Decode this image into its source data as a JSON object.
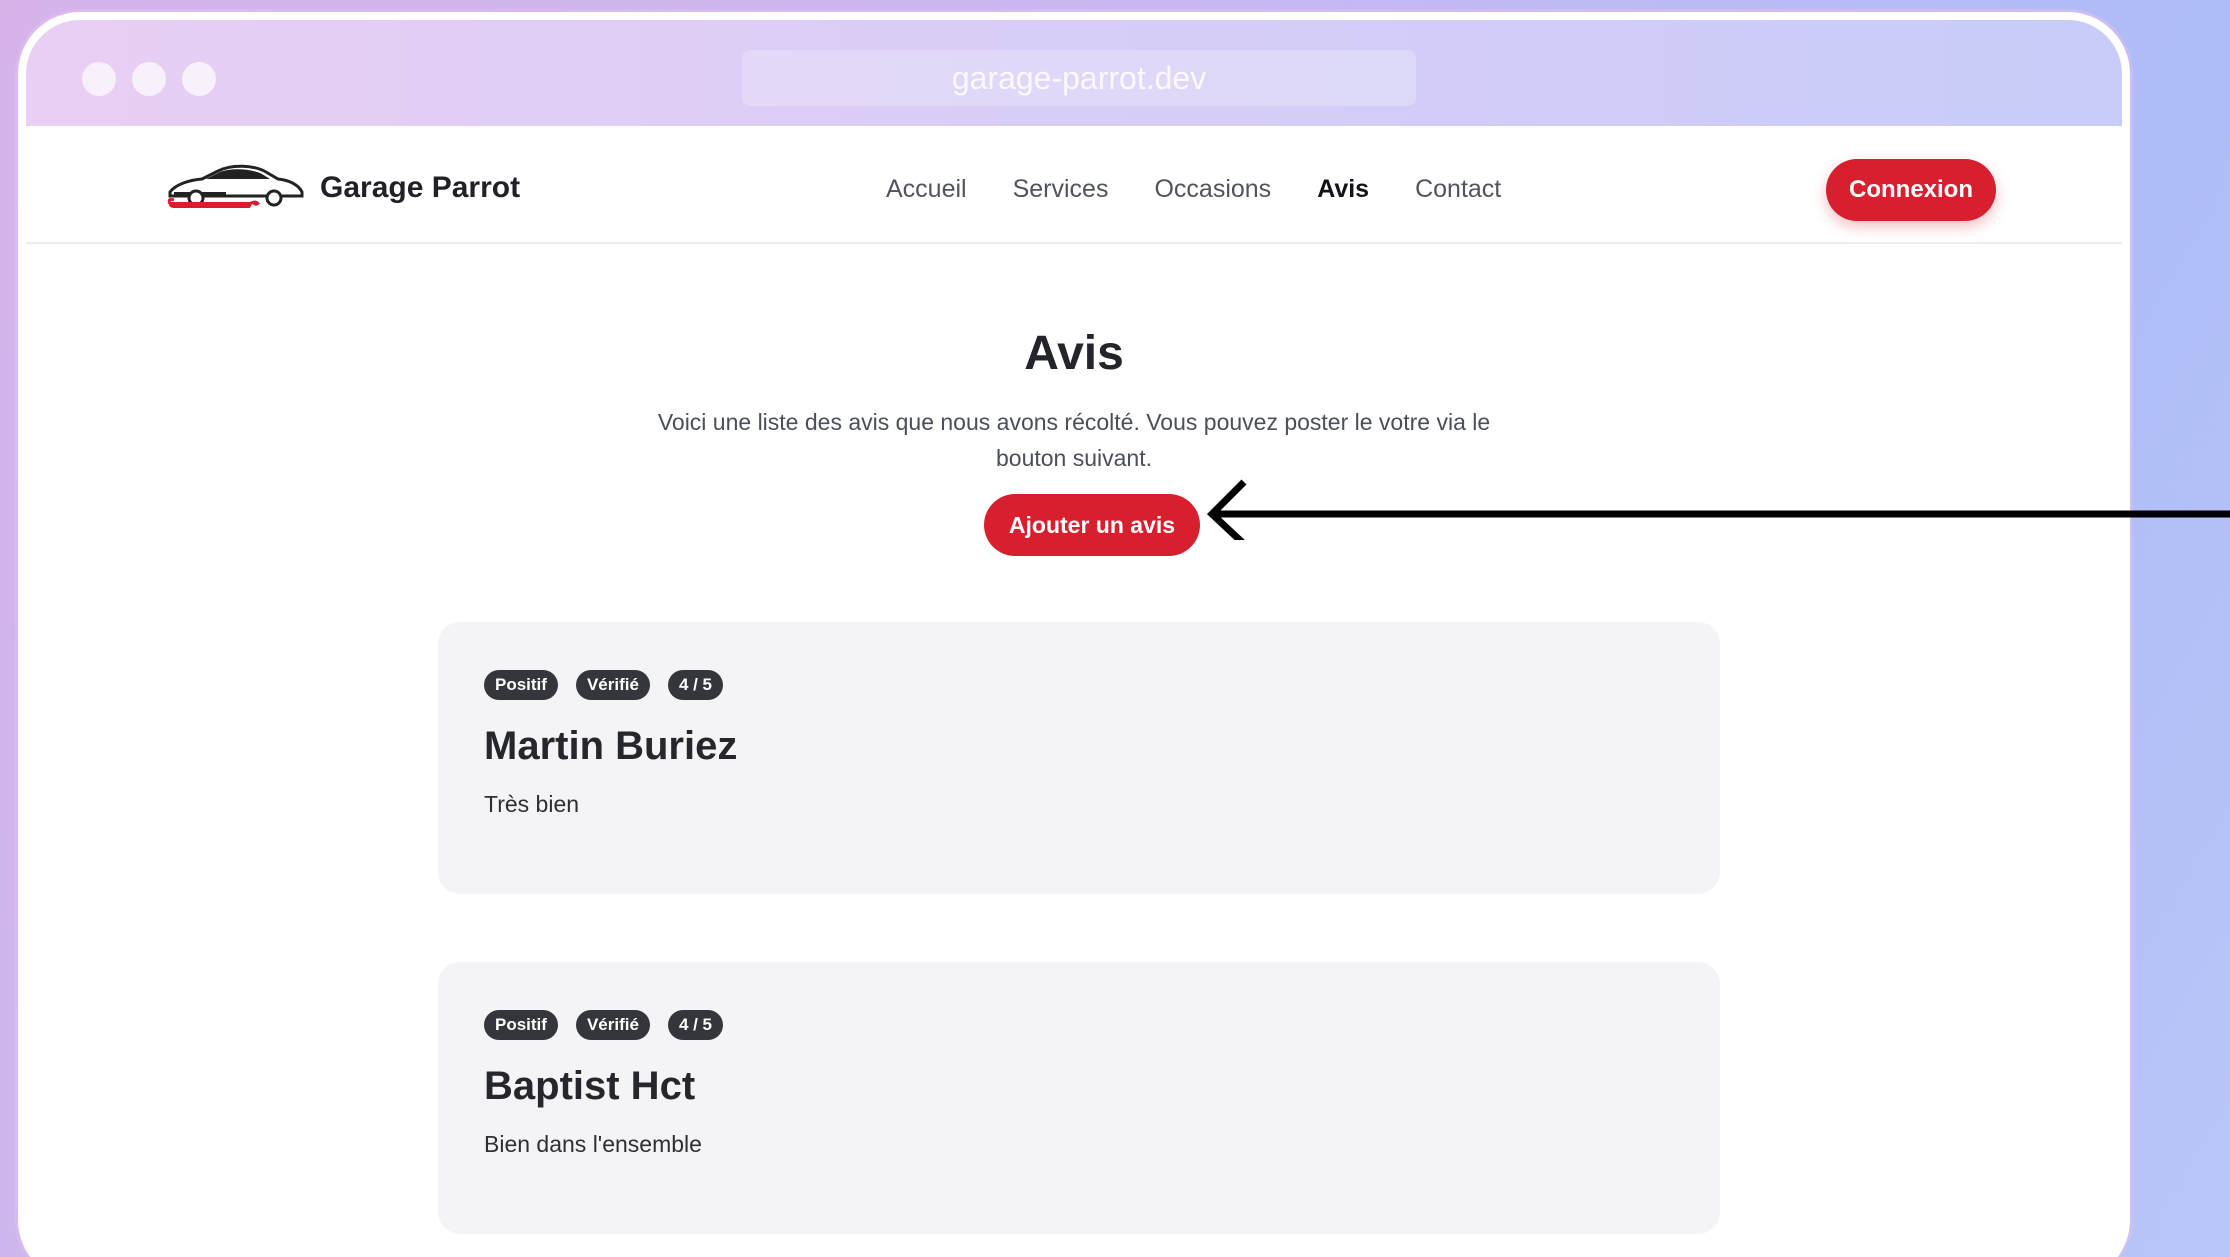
{
  "browser": {
    "url": "garage-parrot.dev"
  },
  "nav": {
    "brand": "Garage Parrot",
    "links": [
      {
        "label": "Accueil",
        "active": false
      },
      {
        "label": "Services",
        "active": false
      },
      {
        "label": "Occasions",
        "active": false
      },
      {
        "label": "Avis",
        "active": true
      },
      {
        "label": "Contact",
        "active": false
      }
    ],
    "login_label": "Connexion"
  },
  "hero": {
    "title": "Avis",
    "description": "Voici une liste des avis que nous avons récolté. Vous pouvez poster le votre via le bouton suivant.",
    "add_button": "Ajouter un avis"
  },
  "reviews": [
    {
      "badges": [
        "Positif",
        "Vérifié",
        "4 / 5"
      ],
      "name": "Martin Buriez",
      "text": "Très bien"
    },
    {
      "badges": [
        "Positif",
        "Vérifié",
        "4 / 5"
      ],
      "name": "Baptist Hct",
      "text": "Bien dans l'ensemble"
    }
  ],
  "colors": {
    "accent": "#d81f2e",
    "badge_bg": "#34363b",
    "card_bg": "#f4f4f6"
  }
}
